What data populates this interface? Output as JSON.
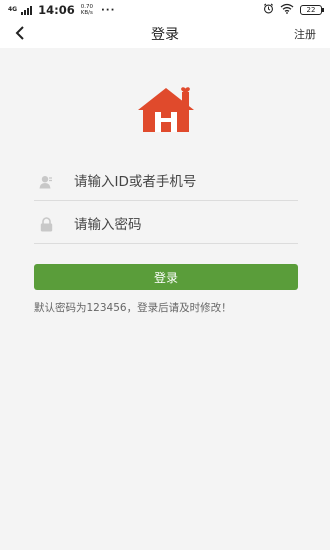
{
  "status_bar": {
    "network": "4G",
    "time": "14:06",
    "speed_value": "0.70",
    "speed_unit": "KB/s",
    "dots": "···",
    "battery": "22"
  },
  "header": {
    "title": "登录",
    "register_label": "注册"
  },
  "form": {
    "account_placeholder": "请输入ID或者手机号",
    "password_placeholder": "请输入密码",
    "login_label": "登录",
    "hint": "默认密码为123456，登录后请及时修改！"
  },
  "icons": {
    "back": "chevron-left-icon",
    "logo": "house-heart-logo",
    "user": "user-icon",
    "lock": "lock-icon",
    "alarm": "alarm-icon",
    "wifi": "wifi-icon"
  },
  "colors": {
    "accent": "#5a9d3a",
    "logo_red": "#e04a2c"
  }
}
